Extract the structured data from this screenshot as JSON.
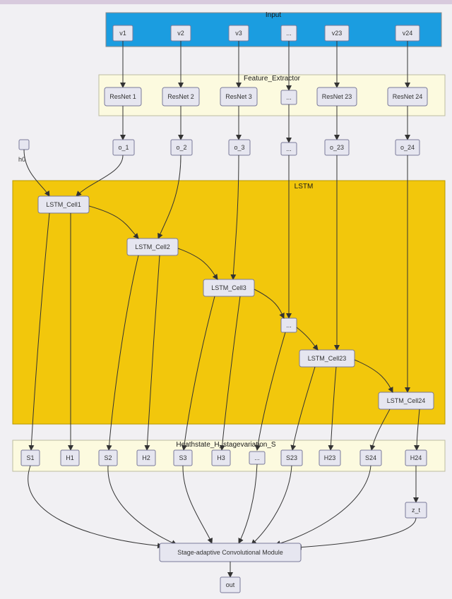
{
  "panels": {
    "input": "Input",
    "feature": "Feature_Extractor",
    "lstm": "LSTM",
    "hs": "Heathstate_H_stagevariation_S"
  },
  "inputs": {
    "v1": "v1",
    "v2": "v2",
    "v3": "v3",
    "ell": "...",
    "v23": "v23",
    "v24": "v24"
  },
  "resnets": {
    "r1": "ResNet 1",
    "r2": "ResNet 2",
    "r3": "ResNet 3",
    "ell": "...",
    "r23": "ResNet 23",
    "r24": "ResNet 24"
  },
  "outputs": {
    "o1": "o_1",
    "o2": "o_2",
    "o3": "o_3",
    "ell": "...",
    "o23": "o_23",
    "o24": "o_24"
  },
  "h0_label": "h0",
  "lstm_cells": {
    "c1": "LSTM_Cell1",
    "c2": "LSTM_Cell2",
    "c3": "LSTM_Cell3",
    "ell": "...",
    "c23": "LSTM_Cell23",
    "c24": "LSTM_Cell24"
  },
  "sh": {
    "s1": "S1",
    "h1": "H1",
    "s2": "S2",
    "h2": "H2",
    "s3": "S3",
    "h3": "H3",
    "ell": "...",
    "s23": "S23",
    "h23": "H23",
    "s24": "S24",
    "h24": "H24"
  },
  "zt": "z_t",
  "stage_module": "Stage-adaptive Convolutional Module",
  "out": "out"
}
